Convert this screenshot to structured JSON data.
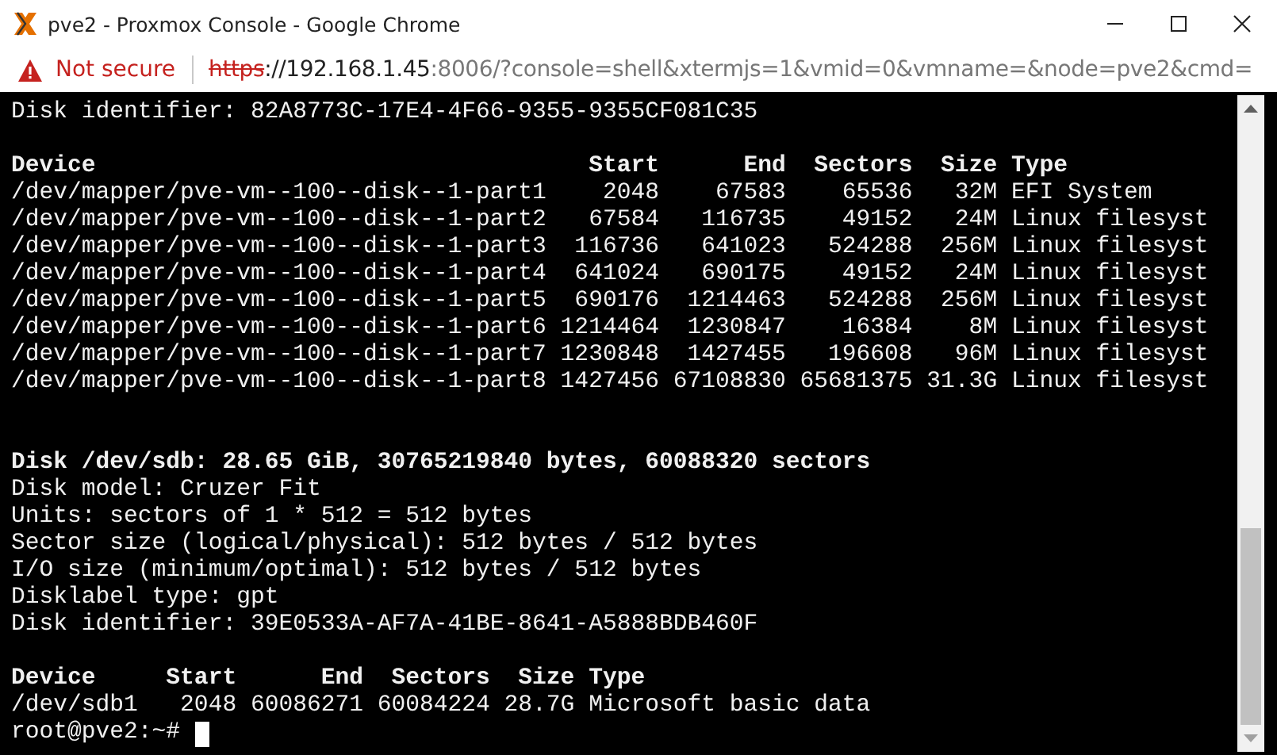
{
  "window": {
    "title": "pve2 - Proxmox Console - Google Chrome"
  },
  "address_bar": {
    "security": "Not secure",
    "url_scheme": "https",
    "url_host": "://192.168.1.45",
    "url_rest": ":8006/?console=shell&xtermjs=1&vmid=0&vmname=&node=pve2&cmd="
  },
  "terminal": {
    "lines": [
      {
        "kind": "text",
        "bold": false,
        "text": "Disk identifier: 82A8773C-17E4-4F66-9355-9355CF081C35"
      },
      {
        "kind": "blank"
      },
      {
        "kind": "text",
        "bold": true,
        "text": "Device                                   Start      End  Sectors  Size Type"
      },
      {
        "kind": "text",
        "bold": false,
        "text": "/dev/mapper/pve-vm--100--disk--1-part1    2048    67583    65536   32M EFI System"
      },
      {
        "kind": "text",
        "bold": false,
        "text": "/dev/mapper/pve-vm--100--disk--1-part2   67584   116735    49152   24M Linux filesyst"
      },
      {
        "kind": "text",
        "bold": false,
        "text": "/dev/mapper/pve-vm--100--disk--1-part3  116736   641023   524288  256M Linux filesyst"
      },
      {
        "kind": "text",
        "bold": false,
        "text": "/dev/mapper/pve-vm--100--disk--1-part4  641024   690175    49152   24M Linux filesyst"
      },
      {
        "kind": "text",
        "bold": false,
        "text": "/dev/mapper/pve-vm--100--disk--1-part5  690176  1214463   524288  256M Linux filesyst"
      },
      {
        "kind": "text",
        "bold": false,
        "text": "/dev/mapper/pve-vm--100--disk--1-part6 1214464  1230847    16384    8M Linux filesyst"
      },
      {
        "kind": "text",
        "bold": false,
        "text": "/dev/mapper/pve-vm--100--disk--1-part7 1230848  1427455   196608   96M Linux filesyst"
      },
      {
        "kind": "text",
        "bold": false,
        "text": "/dev/mapper/pve-vm--100--disk--1-part8 1427456 67108830 65681375 31.3G Linux filesyst"
      },
      {
        "kind": "blank"
      },
      {
        "kind": "blank"
      },
      {
        "kind": "text",
        "bold": true,
        "text": "Disk /dev/sdb: 28.65 GiB, 30765219840 bytes, 60088320 sectors"
      },
      {
        "kind": "text",
        "bold": false,
        "text": "Disk model: Cruzer Fit"
      },
      {
        "kind": "text",
        "bold": false,
        "text": "Units: sectors of 1 * 512 = 512 bytes"
      },
      {
        "kind": "text",
        "bold": false,
        "text": "Sector size (logical/physical): 512 bytes / 512 bytes"
      },
      {
        "kind": "text",
        "bold": false,
        "text": "I/O size (minimum/optimal): 512 bytes / 512 bytes"
      },
      {
        "kind": "text",
        "bold": false,
        "text": "Disklabel type: gpt"
      },
      {
        "kind": "text",
        "bold": false,
        "text": "Disk identifier: 39E0533A-AF7A-41BE-8641-A5888BDB460F"
      },
      {
        "kind": "blank"
      },
      {
        "kind": "text",
        "bold": true,
        "text": "Device     Start      End  Sectors  Size Type"
      },
      {
        "kind": "text",
        "bold": false,
        "text": "/dev/sdb1   2048 60086271 60084224 28.7G Microsoft basic data"
      },
      {
        "kind": "prompt",
        "text": "root@pve2:~#"
      }
    ]
  }
}
